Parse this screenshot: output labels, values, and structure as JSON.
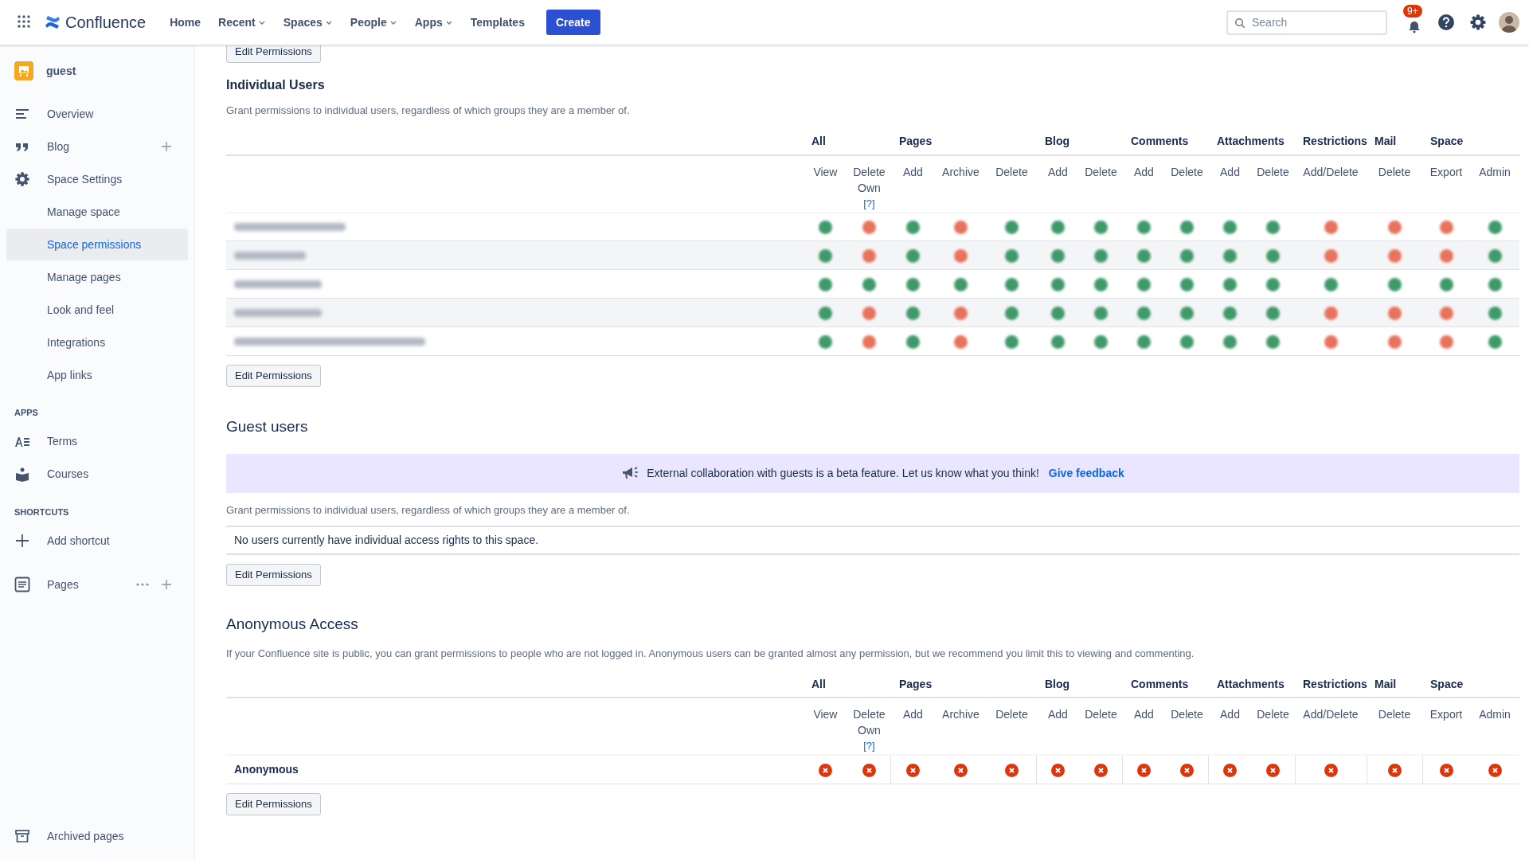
{
  "top_bar": {
    "product": "Confluence",
    "nav": [
      {
        "label": "Home",
        "dropdown": false
      },
      {
        "label": "Recent",
        "dropdown": true
      },
      {
        "label": "Spaces",
        "dropdown": true
      },
      {
        "label": "People",
        "dropdown": true
      },
      {
        "label": "Apps",
        "dropdown": true
      },
      {
        "label": "Templates",
        "dropdown": false
      }
    ],
    "create": "Create",
    "search": {
      "placeholder": "Search"
    },
    "notifications": "9+"
  },
  "sidebar": {
    "space": "guest",
    "items": [
      {
        "label": "Overview",
        "selected": false,
        "sub": false,
        "add": false
      },
      {
        "label": "Blog",
        "selected": false,
        "sub": false,
        "add": true
      },
      {
        "label": "Space Settings",
        "selected": false,
        "sub": false,
        "add": false
      },
      {
        "label": "Manage space",
        "selected": false,
        "sub": true
      },
      {
        "label": "Space permissions",
        "selected": true,
        "sub": true
      },
      {
        "label": "Manage pages",
        "selected": false,
        "sub": true
      },
      {
        "label": "Look and feel",
        "selected": false,
        "sub": true
      },
      {
        "label": "Integrations",
        "selected": false,
        "sub": true
      },
      {
        "label": "App links",
        "selected": false,
        "sub": true
      }
    ],
    "sections": [
      {
        "title": "APPS",
        "items": [
          {
            "label": "Terms"
          },
          {
            "label": "Courses"
          }
        ]
      },
      {
        "title": "SHORTCUTS",
        "items": [
          {
            "label": "Add shortcut"
          }
        ]
      }
    ],
    "pages": "Pages",
    "archived": "Archived pages"
  },
  "content": {
    "top_button": "Edit Permissions",
    "individual_users": {
      "title": "Individual Users",
      "description": "Grant permissions to individual users, regardless of which groups they are a member of.",
      "obscured": true,
      "rows": [
        {
          "permissions": [
            true,
            false,
            true,
            false,
            true,
            true,
            true,
            true,
            true,
            true,
            true,
            false,
            false,
            false,
            true
          ]
        },
        {
          "permissions": [
            true,
            false,
            true,
            false,
            true,
            true,
            true,
            true,
            true,
            true,
            true,
            false,
            false,
            false,
            true
          ]
        },
        {
          "permissions": [
            true,
            true,
            true,
            true,
            true,
            true,
            true,
            true,
            true,
            true,
            true,
            true,
            true,
            true,
            true
          ]
        },
        {
          "permissions": [
            true,
            false,
            true,
            false,
            true,
            true,
            true,
            true,
            true,
            true,
            true,
            false,
            false,
            false,
            true
          ]
        },
        {
          "permissions": [
            true,
            false,
            true,
            false,
            true,
            true,
            true,
            true,
            true,
            true,
            true,
            false,
            false,
            false,
            true
          ]
        }
      ],
      "columns": [
        {
          "label": "All",
          "columns": [
            {
              "label": "View"
            },
            {
              "label": "Delete Own",
              "help": "[?]"
            }
          ]
        },
        {
          "label": "Pages",
          "columns": [
            {
              "label": "Add"
            },
            {
              "label": "Archive"
            },
            {
              "label": "Delete"
            }
          ]
        },
        {
          "label": "Blog",
          "columns": [
            {
              "label": "Add"
            },
            {
              "label": "Delete"
            }
          ]
        },
        {
          "label": "Comments",
          "columns": [
            {
              "label": "Add"
            },
            {
              "label": "Delete"
            }
          ]
        },
        {
          "label": "Attachments",
          "columns": [
            {
              "label": "Add"
            },
            {
              "label": "Delete"
            }
          ]
        },
        {
          "label": "Restrictions",
          "columns": [
            {
              "label": "Add/Delete"
            }
          ]
        },
        {
          "label": "Mail",
          "columns": [
            {
              "label": "Delete"
            }
          ]
        },
        {
          "label": "Space",
          "columns": [
            {
              "label": "Export"
            },
            {
              "label": "Admin"
            }
          ]
        }
      ],
      "button": "Edit Permissions"
    },
    "guest_users": {
      "title": "Guest users",
      "banner": "External collaboration with guests is a beta feature. Let us know what you think!",
      "banner_link": "Give feedback",
      "description": "Grant permissions to individual users, regardless of which groups they are a member of.",
      "empty": "No users currently have individual access rights to this space.",
      "button": "Edit Permissions"
    },
    "anonymous_access": {
      "title": "Anonymous Access",
      "description": "If your Confluence site is public, you can grant permissions to people who are not logged in. Anonymous users can be granted almost any permission, but we recommend you limit this to viewing and commenting.",
      "obscured": false,
      "rows": [
        {
          "name": "Anonymous",
          "permissions": [
            false,
            false,
            false,
            false,
            false,
            false,
            false,
            false,
            false,
            false,
            false,
            false,
            false,
            false,
            false
          ]
        }
      ],
      "columns": [
        {
          "label": "All",
          "columns": [
            {
              "label": "View"
            },
            {
              "label": "Delete Own",
              "help": "[?]"
            }
          ]
        },
        {
          "label": "Pages",
          "columns": [
            {
              "label": "Add"
            },
            {
              "label": "Archive"
            },
            {
              "label": "Delete"
            }
          ]
        },
        {
          "label": "Blog",
          "columns": [
            {
              "label": "Add"
            },
            {
              "label": "Delete"
            }
          ]
        },
        {
          "label": "Comments",
          "columns": [
            {
              "label": "Add"
            },
            {
              "label": "Delete"
            }
          ]
        },
        {
          "label": "Attachments",
          "columns": [
            {
              "label": "Add"
            },
            {
              "label": "Delete"
            }
          ]
        },
        {
          "label": "Restrictions",
          "columns": [
            {
              "label": "Add/Delete"
            }
          ]
        },
        {
          "label": "Mail",
          "columns": [
            {
              "label": "Delete"
            }
          ]
        },
        {
          "label": "Space",
          "columns": [
            {
              "label": "Export"
            },
            {
              "label": "Admin"
            }
          ]
        }
      ],
      "button": "Edit Permissions"
    }
  }
}
